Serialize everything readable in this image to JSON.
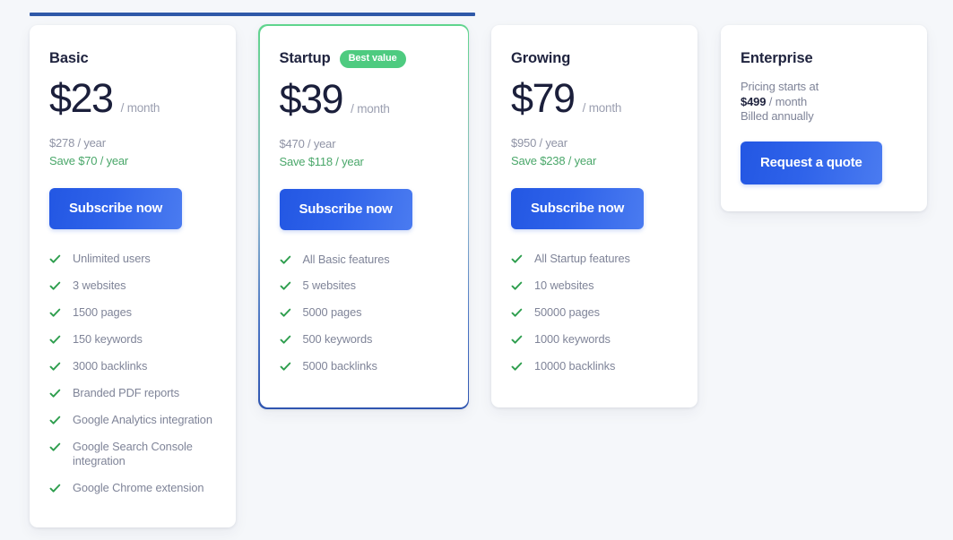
{
  "theme": {
    "page_background": "#f5f7fa",
    "top_rule_color": "#2f59a8",
    "accent_blue": "#2f63ea",
    "accent_green": "#4ecb80",
    "check_green": "#2e9e4e",
    "save_green": "#4aa76a",
    "price_color": "#1b1f3b",
    "muted_text": "#7f8498",
    "highlight_border_top": "#5fd58d",
    "highlight_border_bottom": "#2f55b0"
  },
  "plans": [
    {
      "id": "basic",
      "name": "Basic",
      "badge": null,
      "price_amount": "$23",
      "price_period": "/ month",
      "price_year": "$278 / year",
      "price_save": "Save $70 / year",
      "cta_label": "Subscribe now",
      "highlighted": false,
      "features": [
        "Unlimited users",
        "3 websites",
        "1500 pages",
        "150 keywords",
        "3000 backlinks",
        "Branded PDF reports",
        "Google Analytics integration",
        "Google Search Console integration",
        "Google Chrome extension"
      ]
    },
    {
      "id": "startup",
      "name": "Startup",
      "badge": "Best value",
      "price_amount": "$39",
      "price_period": "/ month",
      "price_year": "$470 / year",
      "price_save": "Save $118 / year",
      "cta_label": "Subscribe now",
      "highlighted": true,
      "features": [
        "All Basic features",
        "5 websites",
        "5000 pages",
        "500 keywords",
        "5000 backlinks"
      ]
    },
    {
      "id": "growing",
      "name": "Growing",
      "badge": null,
      "price_amount": "$79",
      "price_period": "/ month",
      "price_year": "$950 / year",
      "price_save": "Save $238 / year",
      "cta_label": "Subscribe now",
      "highlighted": false,
      "features": [
        "All Startup features",
        "10 websites",
        "50000 pages",
        "1000 keywords",
        "10000 backlinks"
      ]
    }
  ],
  "enterprise": {
    "id": "enterprise",
    "name": "Enterprise",
    "line_1": "Pricing starts at",
    "price_amount": "$499",
    "price_period": "/ month",
    "line_3": "Billed annually",
    "cta_label": "Request a quote"
  },
  "icons": {
    "check": "check-icon"
  }
}
